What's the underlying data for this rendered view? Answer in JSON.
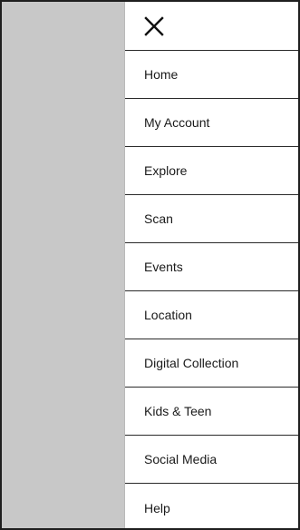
{
  "menu": {
    "close_icon": "close-icon",
    "items": [
      {
        "label": "Home"
      },
      {
        "label": "My Account"
      },
      {
        "label": "Explore"
      },
      {
        "label": "Scan"
      },
      {
        "label": "Events"
      },
      {
        "label": "Location"
      },
      {
        "label": "Digital Collection"
      },
      {
        "label": "Kids & Teen"
      },
      {
        "label": "Social Media"
      },
      {
        "label": "Help"
      }
    ]
  },
  "colors": {
    "backdrop": "#c8c8c8",
    "divider": "#2a2a2a",
    "text": "#1a1a1a",
    "frame": "#1f1f1f"
  }
}
